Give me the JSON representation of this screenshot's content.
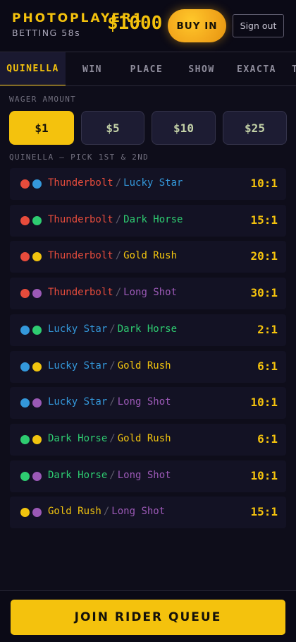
{
  "header": {
    "brand": "PHOTOPLAYER1",
    "status": "BETTING 58s",
    "balance": "$1000",
    "buy_in_label": "BUY IN",
    "sign_out_label": "Sign out"
  },
  "tabs": [
    {
      "label": "QUINELLA",
      "active": true
    },
    {
      "label": "WIN",
      "active": false
    },
    {
      "label": "PLACE",
      "active": false
    },
    {
      "label": "SHOW",
      "active": false
    },
    {
      "label": "EXACTA",
      "active": false
    },
    {
      "label": "TRIFECTA",
      "active": false
    }
  ],
  "wager": {
    "label": "WAGER AMOUNT",
    "amounts": [
      {
        "label": "$1",
        "selected": true
      },
      {
        "label": "$5",
        "selected": false
      },
      {
        "label": "$10",
        "selected": false
      },
      {
        "label": "$25",
        "selected": false
      }
    ]
  },
  "pool": {
    "label": "QUINELLA — PICK 1ST & 2ND",
    "separator": "/",
    "horses": {
      "thunderbolt": {
        "name": "Thunderbolt",
        "color": "#e74c3c"
      },
      "lucky_star": {
        "name": "Lucky Star",
        "color": "#3498db"
      },
      "dark_horse": {
        "name": "Dark Horse",
        "color": "#2ecc71"
      },
      "gold_rush": {
        "name": "Gold Rush",
        "color": "#f1c40f"
      },
      "long_shot": {
        "name": "Long Shot",
        "color": "#9b59b6"
      }
    },
    "combos": [
      {
        "first": "Thunderbolt",
        "first_color": "#e74c3c",
        "second": "Lucky Star",
        "second_color": "#3498db",
        "odds": "10:1"
      },
      {
        "first": "Thunderbolt",
        "first_color": "#e74c3c",
        "second": "Dark Horse",
        "second_color": "#2ecc71",
        "odds": "15:1"
      },
      {
        "first": "Thunderbolt",
        "first_color": "#e74c3c",
        "second": "Gold Rush",
        "second_color": "#f1c40f",
        "odds": "20:1"
      },
      {
        "first": "Thunderbolt",
        "first_color": "#e74c3c",
        "second": "Long Shot",
        "second_color": "#9b59b6",
        "odds": "30:1"
      },
      {
        "first": "Lucky Star",
        "first_color": "#3498db",
        "second": "Dark Horse",
        "second_color": "#2ecc71",
        "odds": "2:1"
      },
      {
        "first": "Lucky Star",
        "first_color": "#3498db",
        "second": "Gold Rush",
        "second_color": "#f1c40f",
        "odds": "6:1"
      },
      {
        "first": "Lucky Star",
        "first_color": "#3498db",
        "second": "Long Shot",
        "second_color": "#9b59b6",
        "odds": "10:1"
      },
      {
        "first": "Dark Horse",
        "first_color": "#2ecc71",
        "second": "Gold Rush",
        "second_color": "#f1c40f",
        "odds": "6:1"
      },
      {
        "first": "Dark Horse",
        "first_color": "#2ecc71",
        "second": "Long Shot",
        "second_color": "#9b59b6",
        "odds": "10:1"
      },
      {
        "first": "Gold Rush",
        "first_color": "#f1c40f",
        "second": "Long Shot",
        "second_color": "#9b59b6",
        "odds": "15:1"
      }
    ]
  },
  "footer": {
    "join_label": "JOIN RIDER QUEUE"
  },
  "colors": {
    "accent": "#f4c20d",
    "background": "#0e0d1a"
  }
}
